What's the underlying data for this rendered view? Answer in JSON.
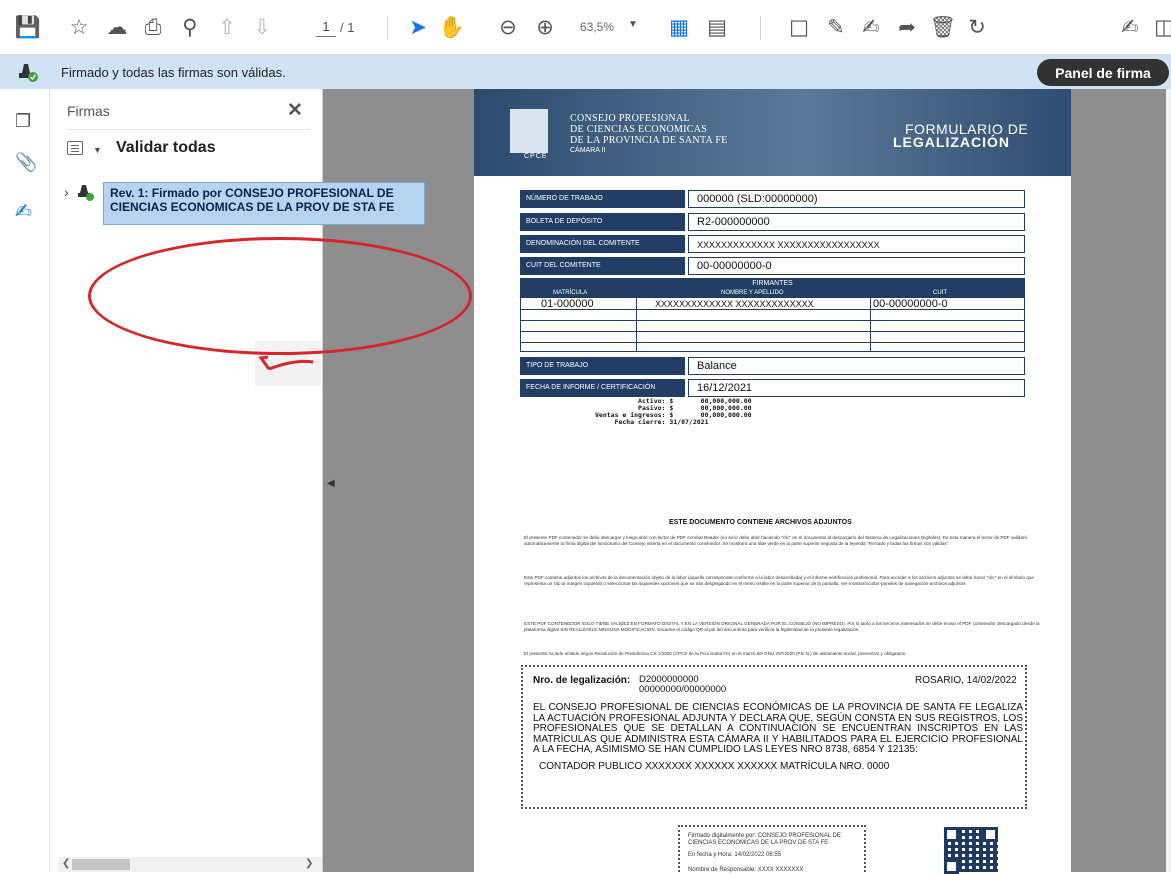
{
  "toolbar": {
    "page_current": "1",
    "page_total": "/ 1",
    "zoom": "63,5%"
  },
  "signature_bar": {
    "status_text": "Firmado y todas las firmas son válidas.",
    "panel_button": "Panel de firma"
  },
  "side_panel": {
    "title": "Firmas",
    "validate_all": "Validar todas",
    "signature_entry": "Rev. 1: Firmado por CONSEJO PROFESIONAL DE CIENCIAS ECONOMICAS DE LA PROV DE STA FE"
  },
  "document": {
    "header": {
      "org_line1": "CONSEJO PROFESIONAL",
      "org_line2": "DE CIENCIAS ECONOMICAS",
      "org_line3": "DE LA PROVINCIA DE SANTA FE",
      "camara": "CÁMARA II",
      "cpce": "CPCE",
      "form_line1": "FORMULARIO DE",
      "form_line2": "LEGALIZACIÓN"
    },
    "fields": [
      {
        "label": "NÚMERO DE TRABAJO",
        "value": "000000    (SLD:00000000)"
      },
      {
        "label": "BOLETA DE DEPÓSITO",
        "value": "R2-000000000"
      },
      {
        "label": "DENOMINACIÓN DEL COMITENTE",
        "value": "XXXXXXXXXXXXX     XXXXXXXXXXXXXXXXX"
      },
      {
        "label": "CUIT DEL COMITENTE",
        "value": "00-00000000-0"
      }
    ],
    "firmantes": {
      "title": "FIRMANTES",
      "col_matricula": "MATRÍCULA",
      "col_nombre": "NOMBRE Y APELLIDO",
      "col_cuit": "CUIT",
      "row_matricula": "01-000000",
      "row_nombre": "XXXXXXXXXXXXX   XXXXXXXXXXXXX",
      "row_cuit": "00-00000000-0"
    },
    "fields2": [
      {
        "label": "TIPO DE TRABAJO",
        "value": "Balance"
      },
      {
        "label": "FECHA DE INFORME / CERTIFICACIÓN",
        "value": "16/12/2021"
      }
    ],
    "summary": "           Activo: $       00,000,000.00\n           Pasivo: $       00,000,000.00\nVentas e ingresos: $       00,000,000.00\n     Fecha cierre: 31/07/2021",
    "attach_title": "ESTE DOCUMENTO CONTIENE ARCHIVOS ADJUNTOS",
    "para1": "El presente PDF contenedor se debe descargar y luego abrir con lector de PDF Acrobat Reader (no se lo debe abrir haciendo \"clic\" en el documento al descargarlo del Sistema de Legalizaciones Digitales). De esta manera el lector de PDF validará automáticamente la firma digital del funcionario del Consejo inserta en el documento contenedor. Se mostrará una tilde verde en la parte superior seguida de la leyenda \"Firmado y todas las firmas son válidas\".",
    "para2": "Este PDF contiene adjuntos los archivos de la documentación objeto de la labor (aquello correspondan conforme a la labor desarrollada) y el informe-certificación profesional. Para acceder a los archivos adjuntos se debe hacer \"clic\" en el símbolo que representa un clip al margen izquierdo o seleccionar las siguientes opciones que se irán desplegando en el menú visible en la parte superior de la pantalla: ver-mostrar/ocultar-paneles de navegación-archivos adjuntos",
    "para3": "ESTE PDF CONTENEDOR SOLO TIENE VALIDEZ EN FORMATO DIGITAL Y EN LA VERSIÓN ORIGINAL GENERADA POR EL CONSEJO (NO IMPRESO). Por lo tanto a los terceros interesados se debe enviar el PDF contenedor descargado desde la plataforma digital SIN REALIZARLE NINGUNA MODIFICACION. Escanee el código QR al pie del documento para verificar la legitimidad de la presente legalización.",
    "para4": "El presente ha sido emitido según Resolución de Presidencia CS 1/2020 (CPCE de la Pcia Santa Fe) en el marco del DNU 297/2020 (P.E.N.) de aislamiento social, preventivo y obligatorio",
    "legal": {
      "label": "Nro. de legalización:",
      "number1": "D2000000000",
      "number2": "00000000/00000000",
      "date": "ROSARIO, 14/02/2022",
      "body": "EL CONSEJO PROFESIONAL DE CIENCIAS ECONÓMICAS DE LA PROVINCIA DE SANTA FE LEGALIZA LA ACTUACIÓN PROFESIONAL ADJUNTA Y DECLARA QUE, SEGÚN CONSTA EN SUS REGISTROS, LOS PROFESIONALES QUE SE DETALLAN A CONTINUACIÓN SE ENCUENTRAN INSCRIPTOS EN LAS MATRÍCULAS QUE ADMINISTRA ESTA CÁMARA II Y HABILITADOS PARA EL EJERCICIO PROFESIONAL A LA FECHA, ASIMISMO SE HAN CUMPLIDO LAS LEYES NRO 8738, 6854 Y 12135:",
      "contador": "CONTADOR PUBLICO  XXXXXXX XXXXXX XXXXXX   MATRÍCULA NRO. 0000"
    },
    "footer": {
      "signed_by": "Firmado digitalmente por: CONSEJO PROFESIONAL DE CIENCIAS ECONOMICAS DE LA PROV DE STA FE",
      "signed_date": "En fecha y Hora: 14/02/2022 08:55",
      "signed_name": "Nombre de Responsable: XXXX XXXXXXX"
    }
  },
  "colors": {
    "accent": "#1473e6",
    "sig_bar": "#d0e3f6",
    "doc_navy": "#213d63",
    "annotation_red": "#d6262a"
  }
}
